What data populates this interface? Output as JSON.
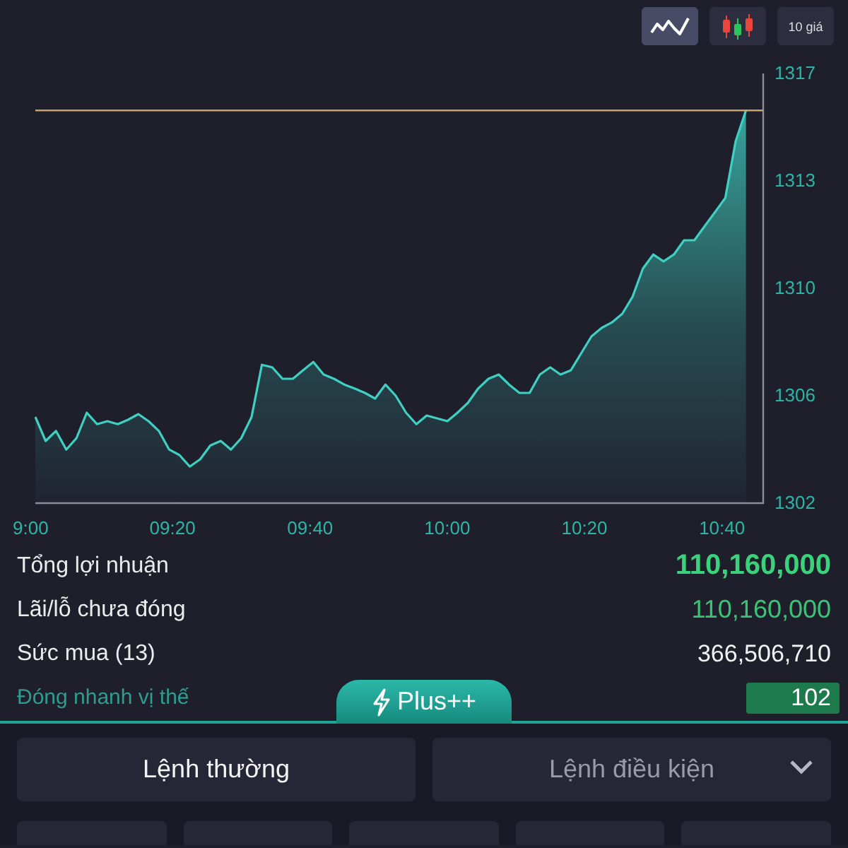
{
  "chart_modes": [
    {
      "kind": "line",
      "selected": true
    },
    {
      "kind": "candle",
      "selected": false
    },
    {
      "kind": "text",
      "label": "10 giá",
      "selected": false
    }
  ],
  "chart": {
    "chart_data": {
      "type": "area",
      "x": [
        9,
        9.025,
        9.05,
        9.075,
        9.1,
        9.125,
        9.15,
        9.175,
        9.2,
        9.225,
        9.25,
        9.275,
        9.3,
        9.325,
        9.35,
        9.375,
        9.4,
        9.425,
        9.45,
        9.475,
        9.5,
        9.525,
        9.55,
        9.575,
        9.6,
        9.625,
        9.65,
        9.675,
        9.7,
        9.725,
        9.75,
        9.775,
        9.8,
        9.825,
        9.85,
        9.875,
        9.9,
        9.925,
        9.95,
        9.975,
        10,
        10.025,
        10.05,
        10.075,
        10.1,
        10.125,
        10.15,
        10.175,
        10.2,
        10.225,
        10.25,
        10.275,
        10.3,
        10.325,
        10.35,
        10.375,
        10.4,
        10.425,
        10.45,
        10.475,
        10.5,
        10.525,
        10.55,
        10.575,
        10.6,
        10.625,
        10.65,
        10.675,
        10.7,
        10.725
      ],
      "series": [
        {
          "color": "#3fd0c2",
          "values": [
            1305.01,
            1304.17,
            1304.52,
            1303.87,
            1304.27,
            1305.16,
            1304.76,
            1304.86,
            1304.76,
            1304.91,
            1305.11,
            1304.86,
            1304.52,
            1303.87,
            1303.68,
            1303.28,
            1303.53,
            1304.02,
            1304.17,
            1303.87,
            1304.27,
            1305.01,
            1306.83,
            1306.74,
            1306.34,
            1306.34,
            1306.64,
            1306.93,
            1306.49,
            1306.34,
            1306.14,
            1306.0,
            1305.85,
            1305.65,
            1306.14,
            1305.75,
            1305.16,
            1304.76,
            1305.06,
            1304.96,
            1304.86,
            1305.16,
            1305.5,
            1306.0,
            1306.34,
            1306.49,
            1306.14,
            1305.85,
            1305.85,
            1306.49,
            1306.74,
            1306.49,
            1306.64,
            1307.23,
            1307.82,
            1308.12,
            1308.31,
            1308.61,
            1309.21,
            1310.19,
            1310.68,
            1310.44,
            1310.68,
            1311.18,
            1311.18,
            1311.67,
            1312.16,
            1312.66,
            1314.63,
            1315.71
          ]
        }
      ],
      "xlim": [
        9,
        10.767
      ],
      "ylim": [
        1302,
        1317
      ],
      "xticks": [
        {
          "value": 9,
          "label": "9:00"
        },
        {
          "value": 9.333,
          "label": "09:20"
        },
        {
          "value": 9.667,
          "label": "09:40"
        },
        {
          "value": 10,
          "label": "10:00"
        },
        {
          "value": 10.333,
          "label": "10:20"
        },
        {
          "value": 10.667,
          "label": "10:40"
        }
      ],
      "yticks": [
        {
          "value": 1302,
          "label": "1302"
        },
        {
          "value": 1305.75,
          "label": "1306"
        },
        {
          "value": 1309.5,
          "label": "1310"
        },
        {
          "value": 1313.25,
          "label": "1313"
        },
        {
          "value": 1317,
          "label": "1317"
        }
      ],
      "ref_lines": [
        {
          "axis": "y",
          "value": 1315.71
        }
      ]
    }
  },
  "summary": [
    {
      "kind": "total",
      "label": "Tổng lợi nhuận",
      "value": "110,160,000"
    },
    {
      "kind": "pnl",
      "label": "Lãi/lỗ chưa đóng",
      "value": "110,160,000"
    },
    {
      "kind": "buying_power",
      "label": "Sức mua (13)",
      "value": "366,506,710"
    }
  ],
  "quick_close": {
    "label": "Đóng nhanh vị thế",
    "value": "102"
  },
  "plus_tab": {
    "label": "Plus++"
  },
  "order_types": [
    {
      "label": "Lệnh thường",
      "selected": true,
      "dropdown": false
    },
    {
      "label": "Lệnh điều kiện",
      "selected": false,
      "dropdown": true
    }
  ],
  "order_buttons": [
    {
      "kind": "button"
    },
    {
      "kind": "button"
    },
    {
      "kind": "button"
    },
    {
      "kind": "button"
    },
    {
      "kind": "button"
    }
  ]
}
